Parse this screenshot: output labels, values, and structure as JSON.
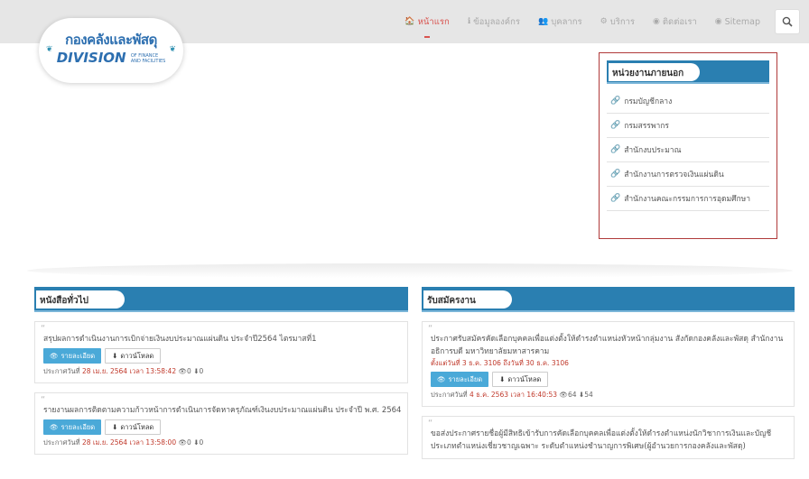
{
  "nav": {
    "items": [
      {
        "icon": "home-icon",
        "glyph": "🏠",
        "label": "หน้าแรก",
        "active": true
      },
      {
        "icon": "info-icon",
        "glyph": "ℹ",
        "label": "ข้อมูลองค์กร",
        "active": false
      },
      {
        "icon": "users-icon",
        "glyph": "👥",
        "label": "บุคลากร",
        "active": false
      },
      {
        "icon": "services-icon",
        "glyph": "⚙",
        "label": "บริการ",
        "active": false
      },
      {
        "icon": "globe-icon",
        "glyph": "◉",
        "label": "ติดต่อเรา",
        "active": false
      },
      {
        "icon": "sitemap-icon",
        "glyph": "◉",
        "label": "Sitemap",
        "active": false
      }
    ]
  },
  "logo": {
    "thai": "กองคลังและพัสดุ",
    "en": "DIVISION",
    "en_small_1": "OF FINANCE",
    "en_small_2": "AND FACILITIES"
  },
  "external": {
    "title": "หน่วยงานภายนอก",
    "items": [
      "กรมบัญชีกลาง",
      "กรมสรรพากร",
      "สำนักงบประมาณ",
      "สำนักงานการตรวจเงินแผ่นดิน",
      "สำนักงานคณะกรรมการการอุดมศึกษา"
    ]
  },
  "news": {
    "title": "หนังสือทั่วไป",
    "detail_label": "รายละเอียด",
    "download_label": "ดาวน์โหลด",
    "items": [
      {
        "title": "สรุปผลการดำเนินงานการเบิกจ่ายเงินงบประมาณแผ่นดิน ประจำปี2564 ไตรมาสที่1",
        "meta_prefix": "ประกาศวันที่ ",
        "date": "28 เม.ย. 2564 เวลา 13:58:42",
        "views": "0",
        "downloads": "0"
      },
      {
        "title": "รายงานผลการติดตามความก้าวหน้าการดำเนินการจัดหาครุภัณฑ์เงินงบประมาณแผ่นดิน ประจำปี พ.ศ. 2564",
        "meta_prefix": "ประกาศวันที่ ",
        "date": "28 เม.ย. 2564 เวลา 13:58:00",
        "views": "0",
        "downloads": "0"
      }
    ]
  },
  "jobs": {
    "title": "รับสมัครงาน",
    "detail_label": "รายละเอียด",
    "download_label": "ดาวน์โหลด",
    "items": [
      {
        "title": "ประกาศรับสมัครคัดเลือกบุคคลเพื่อแต่งตั้งให้ดำรงตำแหน่งหัวหน้ากลุ่มงาน สังกัดกองคลังและพัสดุ สำนักงานอธิการบดี มหาวิทยาลัยมหาสารคาม",
        "period": "ตั้งแต่วันที่ 3 ธ.ค. 3106 ถึงวันที่ 30 ธ.ค. 3106",
        "meta_prefix": "ประกาศวันที่ ",
        "date": "4 ธ.ค. 2563 เวลา 16:40:53",
        "views": "64",
        "downloads": "54"
      },
      {
        "title": "ขอส่งประกาศรายชื่อผู้มีสิทธิเข้ารับการคัดเลือกบุคคลเพื่อแต่งตั้งให้ดำรงตำแหน่งนักวิชาการเงินและบัญชีประเภทตำแหน่งเชี่ยวชาญเฉพาะ ระดับตำแหน่งชำนาญการพิเศษ(ผู้อำนวยการกองคลังและพัสดุ)"
      }
    ]
  }
}
